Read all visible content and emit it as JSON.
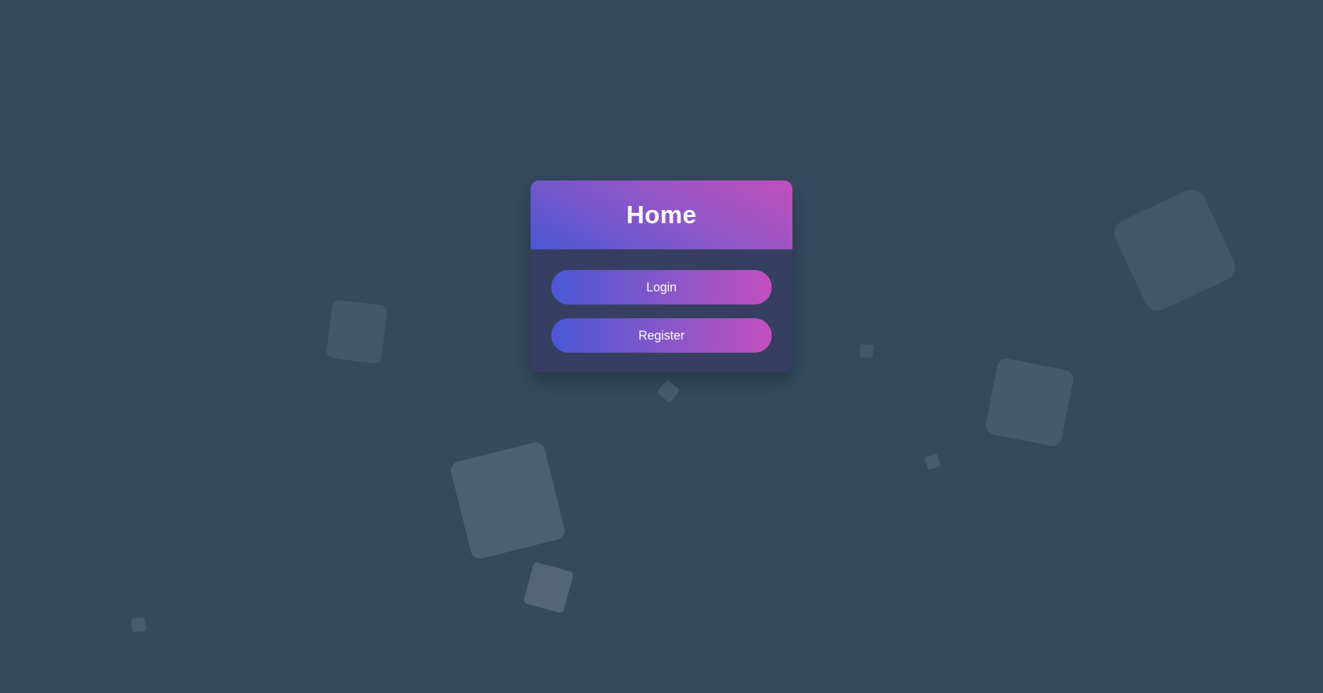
{
  "page": {
    "title": "Home",
    "background_color": "#354a5f"
  },
  "card": {
    "header_gradient": [
      "#4a57d5",
      "#c24fbd"
    ],
    "body_color": "#363f61"
  },
  "buttons": {
    "login_label": "Login",
    "register_label": "Register"
  }
}
